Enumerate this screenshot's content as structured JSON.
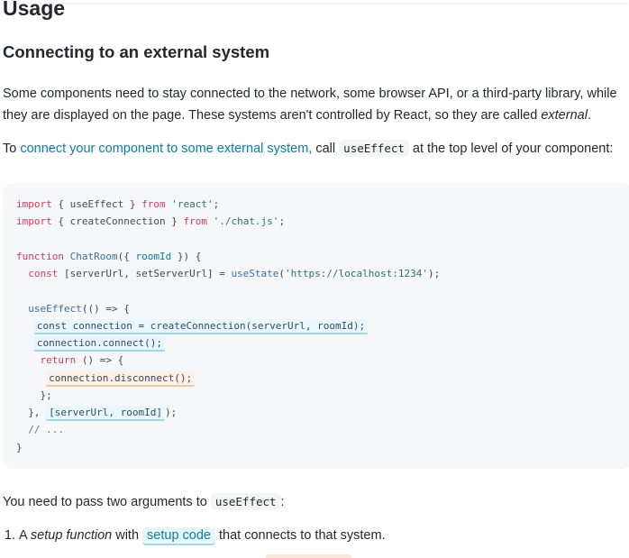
{
  "heading_usage": "Usage",
  "heading_section": "Connecting to an external system",
  "para1": {
    "text": "Some components need to stay connected to the network, some browser API, or a third-party library, while they are displayed on the page. These systems aren't controlled by React, so they are called ",
    "em": "external",
    "end": "."
  },
  "para2": {
    "before": "To ",
    "link": "connect your component to some external system,",
    "mid": " call ",
    "code": "useEffect",
    "after": " at the top level of your component:"
  },
  "code": {
    "l1": {
      "kw1": "import",
      "mid": " { useEffect } ",
      "kw2": "from",
      "str": "'react'",
      "end": ";"
    },
    "l2": {
      "kw1": "import",
      "mid": " { createConnection } ",
      "kw2": "from",
      "str": "'./chat.js'",
      "end": ";"
    },
    "l4": {
      "kw": "function",
      "fn": "ChatRoom",
      "open": "({ ",
      "param": "roomId",
      "close": " }) {"
    },
    "l5": {
      "kw": "const",
      "mid": " [serverUrl, setServerUrl] = ",
      "fn": "useState",
      "open": "(",
      "str": "'https://localhost:1234'",
      "close": ");"
    },
    "l7": {
      "fn": "useEffect",
      "rest": "(() => {"
    },
    "l8": "const connection = createConnection(serverUrl, roomId);",
    "l9": "connection.connect();",
    "l10": {
      "kw": "return",
      "rest": " () => {"
    },
    "l11": "connection.disconnect();",
    "l12": "};",
    "l13": {
      "start": "}, ",
      "deps": "[serverUrl, roomId]",
      "end": ");"
    },
    "l14": "// ...",
    "l15": "}"
  },
  "para3": {
    "before": "You need to pass two arguments to ",
    "code": "useEffect",
    "after": ":"
  },
  "list": [
    {
      "before": "A ",
      "em": "setup function",
      "mid": " with ",
      "pill": "setup code",
      "after": " that connects to that system."
    }
  ]
}
